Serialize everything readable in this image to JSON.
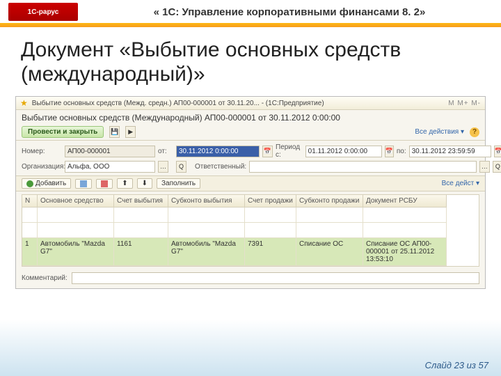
{
  "header": {
    "logo": "1С-рарус",
    "title": "« 1С: Управление корпоративными финансами 8. 2»"
  },
  "main_title": "Документ «Выбытие основных средств (международный)»",
  "app": {
    "tab_title": "Выбытие основных средств (Межд. средн.) АП00-000001 от 30.11.20... - (1С:Предприятие)",
    "nav": "М  М+  М-",
    "form_title": "Выбытие основных средств (Международный) АП00-000001 от 30.11.2012 0:00:00",
    "btn_post_close": "Провести и закрыть",
    "all_actions": "Все действия ▾",
    "labels": {
      "number": "Номер:",
      "from": "от:",
      "period": "Период с:",
      "to": "по:",
      "org": "Организация:",
      "resp": "Ответственный:"
    },
    "values": {
      "number": "АП00-000001",
      "date": "30.11.2012 0:00:00",
      "period_from": "01.11.2012 0:00:00",
      "period_to": "30.11.2012 23:59:59",
      "org": "Альфа, ООО",
      "resp": ""
    },
    "toolbar2": {
      "add": "Добавить",
      "fill": "Заполнить",
      "all_actions2": "Все дейст ▾"
    },
    "table": {
      "headers": [
        "N",
        "Основное средство",
        "Счет выбытия",
        "Субконто выбытия",
        "Счет продажи",
        "Субконто продажи",
        "Документ РСБУ"
      ],
      "row": {
        "n": "1",
        "asset": "Автомобиль \"Mazda G7\"",
        "acct_disp": "1161",
        "subk_disp": "Автомобиль \"Mazda G7\"",
        "acct_sale": "7391",
        "subk_sale": "Списание ОС",
        "doc": "Списание ОС АП00-000001 от 25.11.2012 13:53:10"
      }
    },
    "comment_label": "Комментарий:"
  },
  "footer": "Слайд 23 из 57"
}
